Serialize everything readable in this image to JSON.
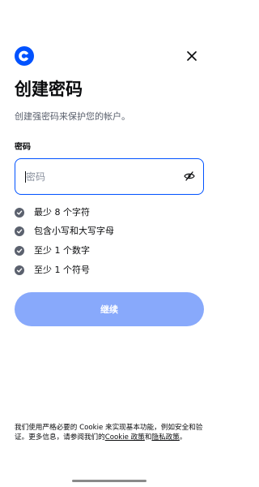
{
  "header": {
    "logo_icon": "coinbase-logo-icon",
    "close_icon": "close-icon",
    "brand_color": "#0052ff"
  },
  "page": {
    "title": "创建密码",
    "subtitle": "创建强密码来保护您的帐户。"
  },
  "password_field": {
    "label": "密码",
    "placeholder": "密码",
    "value": "",
    "toggle_icon": "eye-off-icon"
  },
  "requirements": [
    {
      "text": "最少 8 个字符",
      "icon": "check-circle-icon"
    },
    {
      "text": "包含小写和大写字母",
      "icon": "check-circle-icon"
    },
    {
      "text": "至少 1 个数字",
      "icon": "check-circle-icon"
    },
    {
      "text": "至少 1 个符号",
      "icon": "check-circle-icon"
    }
  ],
  "continue_button": {
    "label": "继续",
    "color": "#88a9fb"
  },
  "cookie_notice": {
    "text": "我们使用严格必要的 Cookie 来实现基本功能，例如安全和验证。更多信息，请参阅我们的",
    "cookie_policy_link": "Cookie 政策",
    "conjunction": "和",
    "privacy_policy_link": "隐私政策",
    "end": "。"
  }
}
